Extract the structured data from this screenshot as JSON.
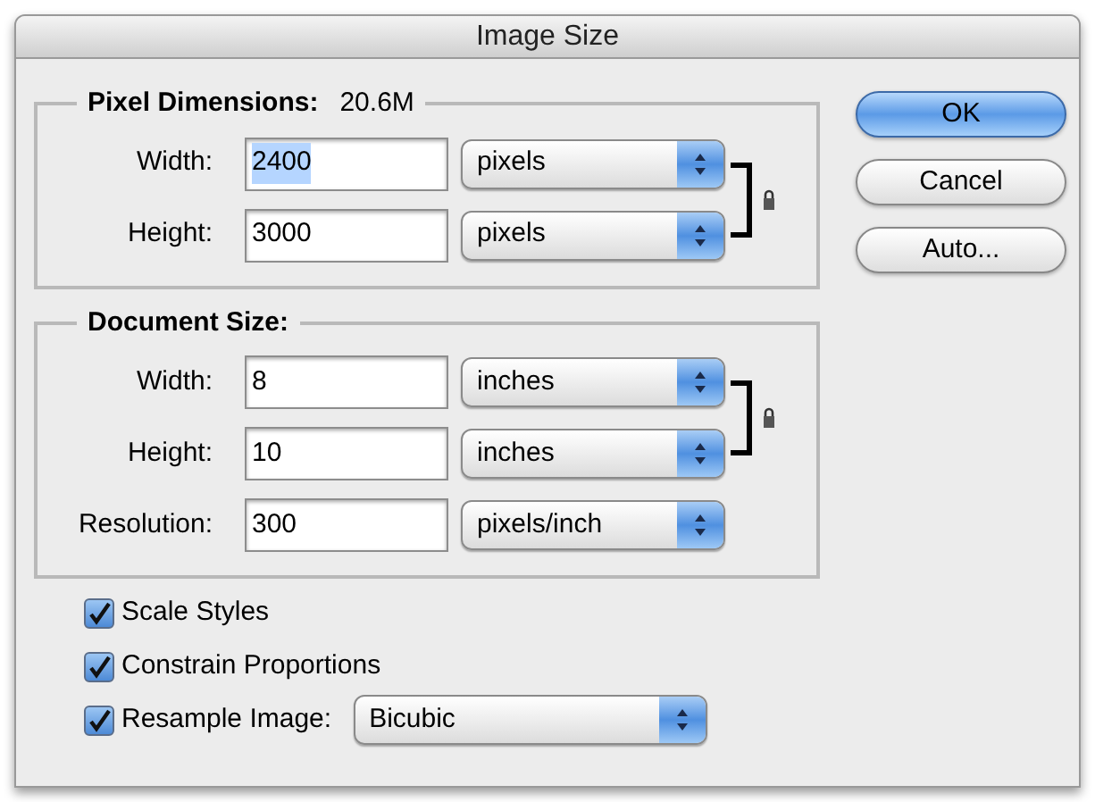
{
  "window": {
    "title": "Image Size"
  },
  "groups": [
    {
      "title": "Pixel Dimensions:",
      "value": "20.6M",
      "rows": [
        {
          "label": "Width:",
          "value": "2400",
          "text_selected": true,
          "unit": "pixels",
          "linked": true
        },
        {
          "label": "Height:",
          "value": "3000",
          "text_selected": false,
          "unit": "pixels",
          "linked": true
        }
      ]
    },
    {
      "title": "Document Size:",
      "rows": [
        {
          "label": "Width:",
          "value": "8",
          "text_selected": false,
          "unit": "inches",
          "linked": true
        },
        {
          "label": "Height:",
          "value": "10",
          "text_selected": false,
          "unit": "inches",
          "linked": true
        },
        {
          "label": "Resolution:",
          "value": "300",
          "text_selected": false,
          "unit": "pixels/inch",
          "linked": false
        }
      ]
    }
  ],
  "options": [
    {
      "kind": "checkbox",
      "label": "Scale Styles",
      "checked": true
    },
    {
      "kind": "checkbox",
      "label": "Constrain Proportions",
      "checked": true
    },
    {
      "kind": "checkbox-select",
      "label": "Resample Image:",
      "checked": true,
      "select": "Bicubic"
    }
  ],
  "buttons": [
    {
      "label": "OK",
      "default": true
    },
    {
      "label": "Cancel",
      "default": false
    },
    {
      "label": "Auto...",
      "default": false
    }
  ]
}
